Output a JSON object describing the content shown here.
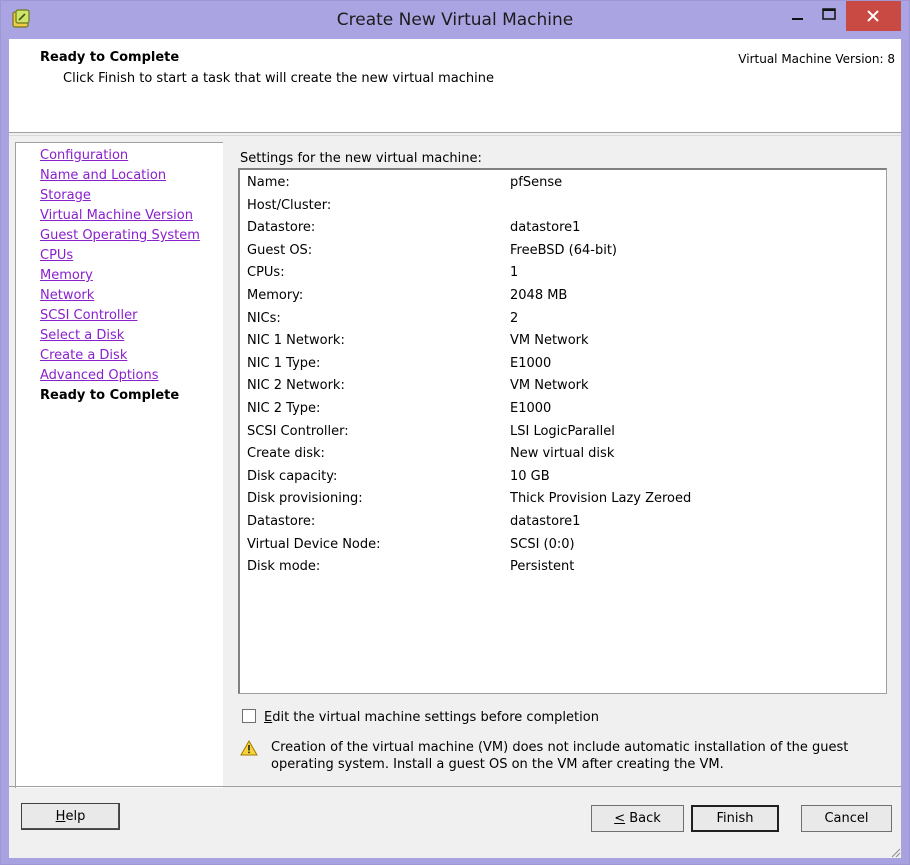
{
  "window": {
    "title": "Create New Virtual Machine"
  },
  "header": {
    "title": "Ready to Complete",
    "subtitle": "Click Finish to start a task that will create the new virtual machine",
    "version": "Virtual Machine Version: 8"
  },
  "nav": {
    "items": [
      {
        "label": "Configuration",
        "current": false
      },
      {
        "label": "Name and Location",
        "current": false
      },
      {
        "label": "Storage",
        "current": false
      },
      {
        "label": "Virtual Machine Version",
        "current": false
      },
      {
        "label": "Guest Operating System",
        "current": false
      },
      {
        "label": "CPUs",
        "current": false
      },
      {
        "label": "Memory",
        "current": false
      },
      {
        "label": "Network",
        "current": false
      },
      {
        "label": "SCSI Controller",
        "current": false
      },
      {
        "label": "Select a Disk",
        "current": false
      },
      {
        "label": "Create a Disk",
        "current": false
      },
      {
        "label": "Advanced Options",
        "current": false
      },
      {
        "label": "Ready to Complete",
        "current": true
      }
    ]
  },
  "settings": {
    "label": "Settings for the new virtual machine:",
    "rows": [
      {
        "key": "Name:",
        "value": "pfSense"
      },
      {
        "key": "Host/Cluster:",
        "value": ""
      },
      {
        "key": "Datastore:",
        "value": "datastore1"
      },
      {
        "key": "Guest OS:",
        "value": "FreeBSD (64-bit)"
      },
      {
        "key": "CPUs:",
        "value": "1"
      },
      {
        "key": "Memory:",
        "value": "2048 MB"
      },
      {
        "key": "NICs:",
        "value": "2"
      },
      {
        "key": "NIC 1 Network:",
        "value": "VM Network"
      },
      {
        "key": "NIC 1 Type:",
        "value": "E1000"
      },
      {
        "key": "NIC 2 Network:",
        "value": "VM Network"
      },
      {
        "key": "NIC 2 Type:",
        "value": "E1000"
      },
      {
        "key": "SCSI Controller:",
        "value": "LSI LogicParallel"
      },
      {
        "key": "Create disk:",
        "value": "New virtual disk"
      },
      {
        "key": "Disk capacity:",
        "value": "10 GB"
      },
      {
        "key": "Disk provisioning:",
        "value": "Thick Provision Lazy Zeroed"
      },
      {
        "key": "Datastore:",
        "value": "datastore1"
      },
      {
        "key": "Virtual Device Node:",
        "value": "SCSI (0:0)"
      },
      {
        "key": "Disk mode:",
        "value": "Persistent"
      }
    ]
  },
  "edit_checkbox": {
    "label": "Edit the virtual machine settings before completion",
    "checked": false
  },
  "warning": {
    "text": "Creation of the virtual machine (VM) does not include automatic installation of the guest operating system. Install a guest OS on the VM after creating the VM."
  },
  "buttons": {
    "help": "Help",
    "back": "< Back",
    "finish": "Finish",
    "cancel": "Cancel"
  },
  "colors": {
    "title_bar": "#aaa4e2",
    "close_button": "#c94a42",
    "link": "#8a20cc",
    "dialog_bg": "#f0f0f0"
  }
}
